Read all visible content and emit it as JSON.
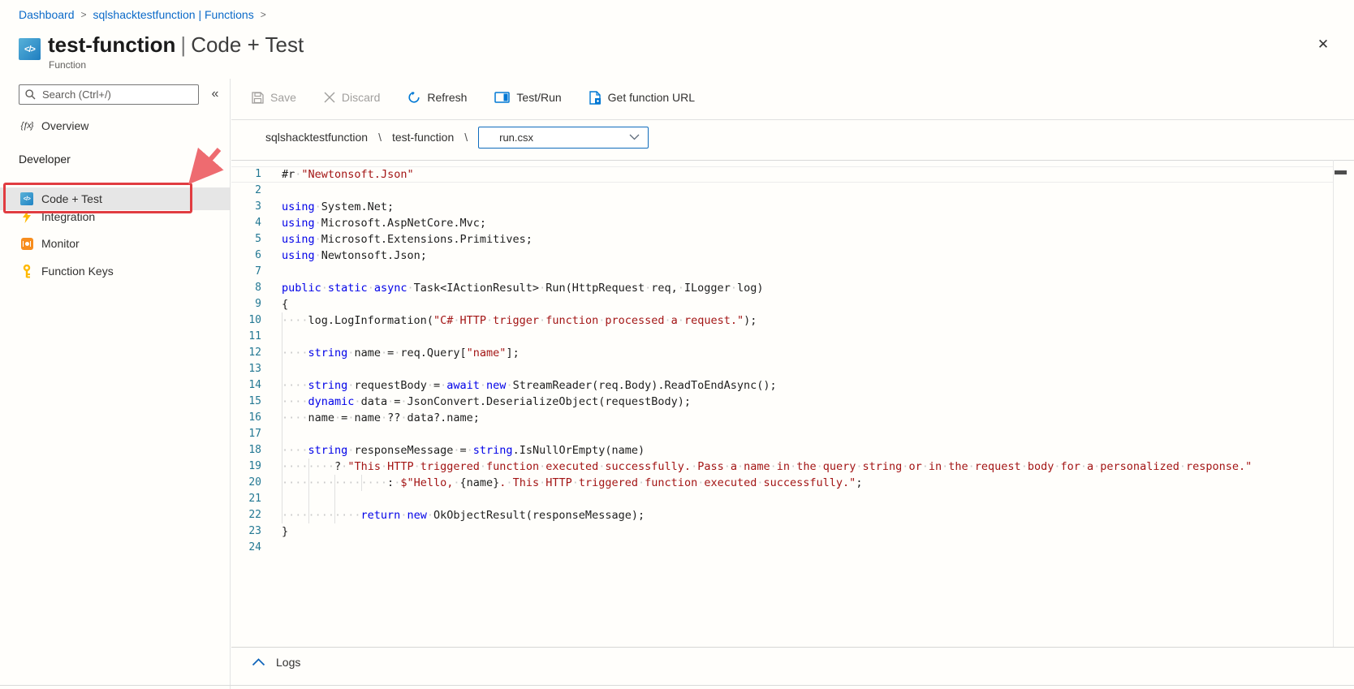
{
  "breadcrumb": {
    "items": [
      "Dashboard",
      "sqlshacktestfunction | Functions"
    ],
    "separator": ">"
  },
  "header": {
    "title": "test-function",
    "title_separator": "|",
    "context": "Code + Test",
    "subtitle": "Function",
    "icon_glyph": "</>",
    "close_glyph": "✕"
  },
  "sidebar": {
    "search": {
      "placeholder": "Search (Ctrl+/)"
    },
    "collapse_glyph": "«",
    "overview": {
      "label": "Overview",
      "icon_glyph": "{ƒx}"
    },
    "section_label": "Developer",
    "items": [
      {
        "label": "Code + Test",
        "icon": "code-test-icon",
        "icon_glyph": "</>",
        "active": true
      },
      {
        "label": "Integration",
        "icon": "lightning-icon",
        "active": false
      },
      {
        "label": "Monitor",
        "icon": "monitor-icon",
        "active": false
      },
      {
        "label": "Function Keys",
        "icon": "key-icon",
        "active": false
      }
    ]
  },
  "toolbar": {
    "save": "Save",
    "discard": "Discard",
    "refresh": "Refresh",
    "test_run": "Test/Run",
    "get_function_url": "Get function URL"
  },
  "filebar": {
    "app": "sqlshacktestfunction",
    "separator": "\\",
    "function": "test-function",
    "file_selected": "run.csx"
  },
  "editor": {
    "lines": [
      {
        "g": 0,
        "t": [
          [
            "#r ",
            "d"
          ],
          [
            "\"Newtonsoft.Json\"",
            "s"
          ]
        ]
      },
      {
        "g": 0,
        "t": []
      },
      {
        "g": 0,
        "t": [
          [
            "using",
            "k"
          ],
          [
            " System.Net;",
            "d"
          ]
        ]
      },
      {
        "g": 0,
        "t": [
          [
            "using",
            "k"
          ],
          [
            " Microsoft.AspNetCore.Mvc;",
            "d"
          ]
        ]
      },
      {
        "g": 0,
        "t": [
          [
            "using",
            "k"
          ],
          [
            " Microsoft.Extensions.Primitives;",
            "d"
          ]
        ]
      },
      {
        "g": 0,
        "t": [
          [
            "using",
            "k"
          ],
          [
            " Newtonsoft.Json;",
            "d"
          ]
        ]
      },
      {
        "g": 0,
        "t": []
      },
      {
        "g": 0,
        "t": [
          [
            "public",
            "k"
          ],
          [
            " ",
            "d"
          ],
          [
            "static",
            "k"
          ],
          [
            " ",
            "d"
          ],
          [
            "async",
            "k"
          ],
          [
            " Task<IActionResult> Run(HttpRequest req, ILogger log)",
            "d"
          ]
        ]
      },
      {
        "g": 0,
        "t": [
          [
            "{",
            "d"
          ]
        ]
      },
      {
        "g": 1,
        "t": [
          [
            "    log.LogInformation(",
            "d"
          ],
          [
            "\"C# HTTP trigger function processed a request.\"",
            "s"
          ],
          [
            ");",
            "d"
          ]
        ]
      },
      {
        "g": 1,
        "t": []
      },
      {
        "g": 1,
        "t": [
          [
            "    ",
            "d"
          ],
          [
            "string",
            "k"
          ],
          [
            " name = req.Query[",
            "d"
          ],
          [
            "\"name\"",
            "s"
          ],
          [
            "];",
            "d"
          ]
        ]
      },
      {
        "g": 1,
        "t": []
      },
      {
        "g": 1,
        "t": [
          [
            "    ",
            "d"
          ],
          [
            "string",
            "k"
          ],
          [
            " requestBody = ",
            "d"
          ],
          [
            "await",
            "k"
          ],
          [
            " ",
            "d"
          ],
          [
            "new",
            "k"
          ],
          [
            " StreamReader(req.Body).ReadToEndAsync();",
            "d"
          ]
        ]
      },
      {
        "g": 1,
        "t": [
          [
            "    ",
            "d"
          ],
          [
            "dynamic",
            "k"
          ],
          [
            " data = JsonConvert.DeserializeObject(requestBody);",
            "d"
          ]
        ]
      },
      {
        "g": 1,
        "t": [
          [
            "    name = name ?? data?.name;",
            "d"
          ]
        ]
      },
      {
        "g": 1,
        "t": []
      },
      {
        "g": 1,
        "t": [
          [
            "    ",
            "d"
          ],
          [
            "string",
            "k"
          ],
          [
            " responseMessage = ",
            "d"
          ],
          [
            "string",
            "k"
          ],
          [
            ".IsNullOrEmpty(name)",
            "d"
          ]
        ]
      },
      {
        "g": 2,
        "t": [
          [
            "        ? ",
            "d"
          ],
          [
            "\"This HTTP triggered function executed successfully. Pass a name in the query string or in the request body for a personalized response.\"",
            "s"
          ]
        ]
      },
      {
        "g": 4,
        "t": [
          [
            "                : ",
            "d"
          ],
          [
            "$\"Hello, ",
            "s"
          ],
          [
            "{name}",
            "d"
          ],
          [
            ". This HTTP triggered function executed successfully.\"",
            "s"
          ],
          [
            ";",
            "d"
          ]
        ]
      },
      {
        "g": 3,
        "t": []
      },
      {
        "g": 3,
        "t": [
          [
            "            ",
            "d"
          ],
          [
            "return",
            "k"
          ],
          [
            " ",
            "d"
          ],
          [
            "new",
            "k"
          ],
          [
            " OkObjectResult(responseMessage);",
            "d"
          ]
        ]
      },
      {
        "g": 0,
        "t": [
          [
            "}",
            "d"
          ]
        ]
      },
      {
        "g": 0,
        "t": []
      }
    ]
  },
  "logs": {
    "label": "Logs"
  },
  "colors": {
    "accent_blue": "#0078d4",
    "link_blue": "#0b6ac9",
    "annotation_red": "#e13c41",
    "keyword_blue": "#0000e8",
    "string_red": "#a31515",
    "line_number_teal": "#237893",
    "integration_gold": "#ffb900",
    "monitor_orange": "#f78d1e"
  }
}
